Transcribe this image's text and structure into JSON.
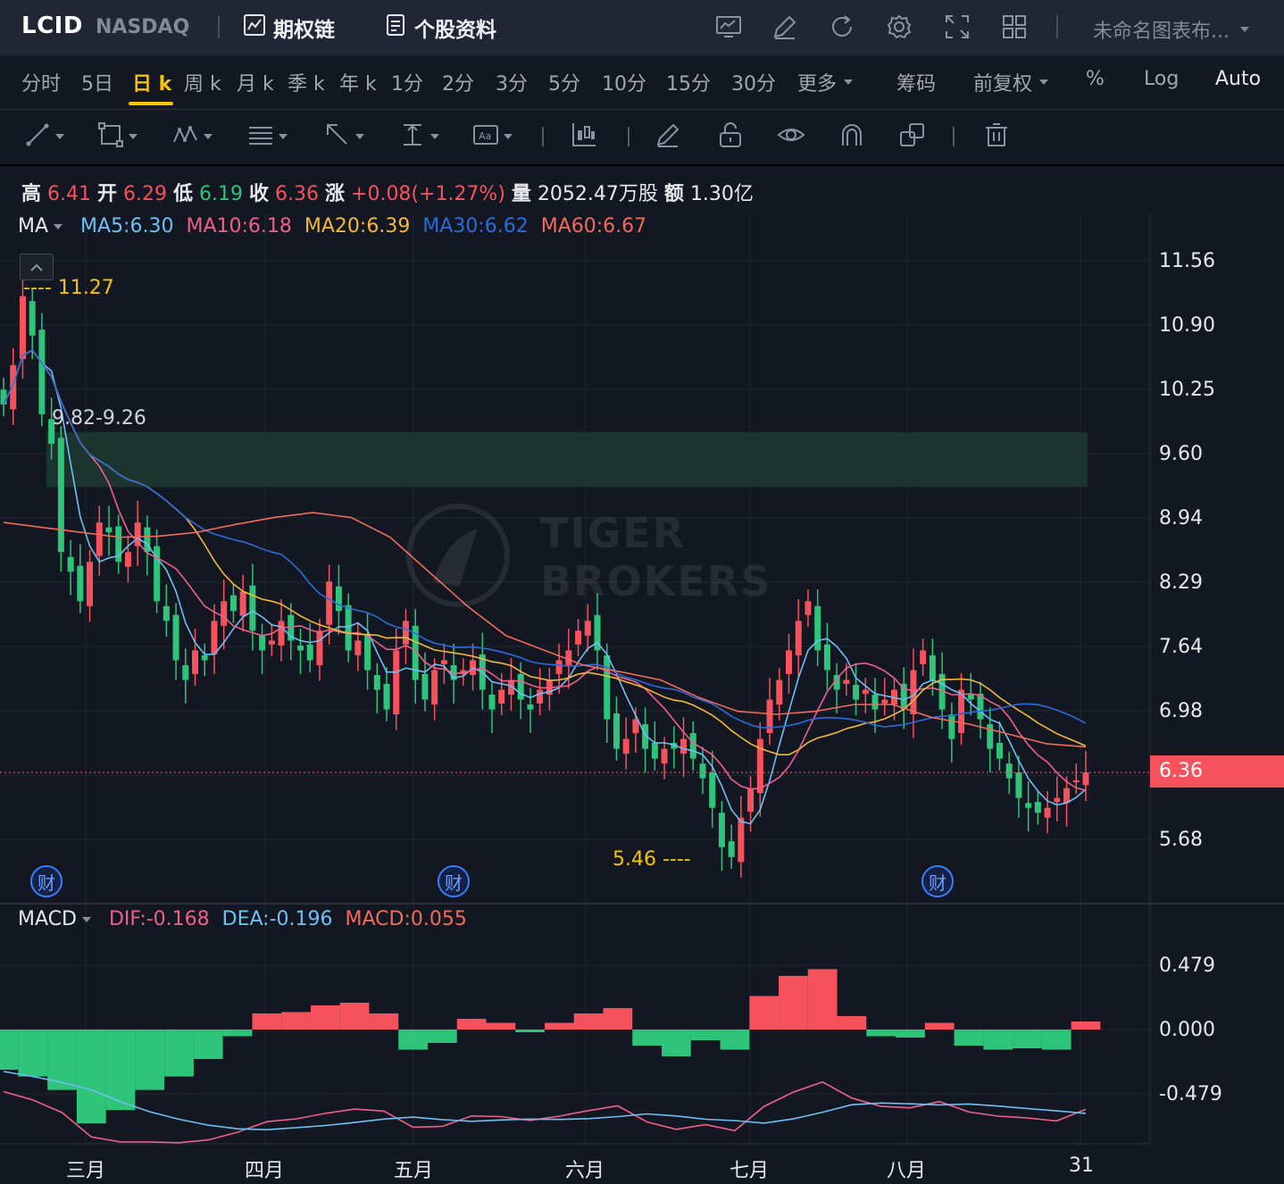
{
  "header": {
    "ticker": "LCID",
    "exchange": "NASDAQ",
    "options_chain_label": "期权链",
    "stock_profile_label": "个股资料",
    "layout_name": "未命名图表布..."
  },
  "periods": [
    "分时",
    "5日",
    "日 k",
    "周 k",
    "月 k",
    "季 k",
    "年 k",
    "1分",
    "2分",
    "3分",
    "5分",
    "10分",
    "15分",
    "30分",
    "更多"
  ],
  "active_period": "日 k",
  "right_options": {
    "chips_label": "筹码",
    "adjust_label": "前复权",
    "percent_label": "%",
    "log_label": "Log",
    "auto_label": "Auto"
  },
  "ohlc": {
    "high_label": "高",
    "high": "6.41",
    "open_label": "开",
    "open": "6.29",
    "low_label": "低",
    "low": "6.19",
    "close_label": "收",
    "close": "6.36",
    "change_label": "涨",
    "change": "+0.08(+1.27%)",
    "volume_label": "量",
    "volume": "2052.47万股",
    "amount_label": "额",
    "amount": "1.30亿"
  },
  "ma_legend": {
    "name": "MA",
    "items": [
      {
        "text": "MA5:6.30",
        "color": "#6ec0f5"
      },
      {
        "text": "MA10:6.18",
        "color": "#ef5f8b"
      },
      {
        "text": "MA20:6.39",
        "color": "#f3b73a"
      },
      {
        "text": "MA30:6.62",
        "color": "#2d6bdb"
      },
      {
        "text": "MA60:6.67",
        "color": "#f26a5a"
      }
    ]
  },
  "macd_legend": {
    "name": "MACD",
    "items": [
      {
        "text": "DIF:-0.168",
        "color": "#ef5f8b"
      },
      {
        "text": "DEA:-0.196",
        "color": "#6ec0f5"
      },
      {
        "text": "MACD:0.055",
        "color": "#f26a5a"
      }
    ]
  },
  "price_axis": [
    "11.56",
    "10.90",
    "10.25",
    "9.60",
    "8.94",
    "8.29",
    "7.64",
    "6.98",
    "6.36",
    "5.68"
  ],
  "current_price": "6.36",
  "macd_axis": [
    "0.479",
    "0.000",
    "-0.479"
  ],
  "date_axis": [
    "三月",
    "四月",
    "五月",
    "六月",
    "七月",
    "八月",
    "31"
  ],
  "annotations": {
    "high_marker": "---- 11.27",
    "low_marker": "5.46 ----",
    "zone_label": "9.82-9.26"
  },
  "earnings_badge": "财",
  "watermark": {
    "line1": "TIGER",
    "line2": "BROKERS"
  },
  "colors": {
    "up": "#f6525d",
    "down": "#2ec47a",
    "accent": "#f5c500",
    "background": "#131722",
    "zone": "#1f3a30"
  },
  "chart_data": {
    "type": "candlestick",
    "price_range": [
      5.1,
      11.9
    ],
    "zone": [
      9.26,
      9.82
    ],
    "last_price": 6.36,
    "price_high": 11.27,
    "price_low": 5.46,
    "candles_close": [
      10.1,
      10.5,
      11.2,
      10.8,
      10.0,
      9.7,
      8.6,
      8.4,
      8.1,
      8.5,
      8.9,
      8.8,
      8.5,
      8.6,
      8.9,
      8.6,
      8.1,
      7.9,
      7.5,
      7.3,
      7.6,
      7.5,
      7.9,
      8.1,
      8.0,
      8.2,
      7.8,
      7.6,
      7.7,
      7.9,
      7.7,
      7.6,
      7.5,
      7.8,
      8.3,
      8.0,
      7.6,
      7.7,
      7.4,
      7.2,
      7.0,
      7.6,
      7.9,
      7.3,
      7.1,
      7.4,
      7.5,
      7.3,
      7.4,
      7.5,
      7.2,
      7.0,
      7.2,
      7.3,
      7.1,
      7.0,
      7.2,
      7.3,
      7.5,
      7.6,
      7.8,
      7.9,
      7.6,
      6.9,
      6.6,
      6.7,
      6.9,
      6.6,
      6.5,
      6.6,
      6.6,
      6.7,
      6.5,
      6.3,
      6.0,
      5.6,
      5.5,
      5.9,
      6.2,
      6.7,
      7.1,
      7.3,
      7.6,
      7.9,
      8.1,
      7.6,
      7.4,
      7.2,
      7.3,
      7.1,
      7.2,
      7.0,
      7.1,
      7.2,
      7.0,
      7.4,
      7.6,
      7.3,
      7.0,
      6.7,
      7.2,
      7.1,
      6.9,
      6.6,
      6.5,
      6.3,
      6.1,
      6.0,
      5.95,
      6.0,
      6.1,
      6.2,
      6.28,
      6.36
    ],
    "ma60": [
      8.9,
      8.85,
      8.8,
      8.75,
      8.76,
      8.8,
      8.88,
      8.95,
      9.0,
      8.95,
      8.75,
      8.4,
      8.05,
      7.75,
      7.6,
      7.45,
      7.38,
      7.3,
      7.12,
      6.98,
      6.95,
      6.98,
      7.05,
      7.05,
      6.92,
      6.85,
      6.75,
      6.65,
      6.62
    ],
    "macd_range": [
      -0.8,
      0.8
    ],
    "macd_hist": [
      -0.3,
      -0.35,
      -0.45,
      -0.7,
      -0.6,
      -0.45,
      -0.35,
      -0.22,
      -0.05,
      0.12,
      0.13,
      0.18,
      0.2,
      0.12,
      -0.15,
      -0.1,
      0.08,
      0.05,
      -0.02,
      0.05,
      0.12,
      0.16,
      -0.12,
      -0.2,
      -0.08,
      -0.15,
      0.25,
      0.4,
      0.45,
      0.1,
      -0.05,
      -0.06,
      0.05,
      -0.12,
      -0.15,
      -0.14,
      -0.15,
      0.06
    ]
  }
}
